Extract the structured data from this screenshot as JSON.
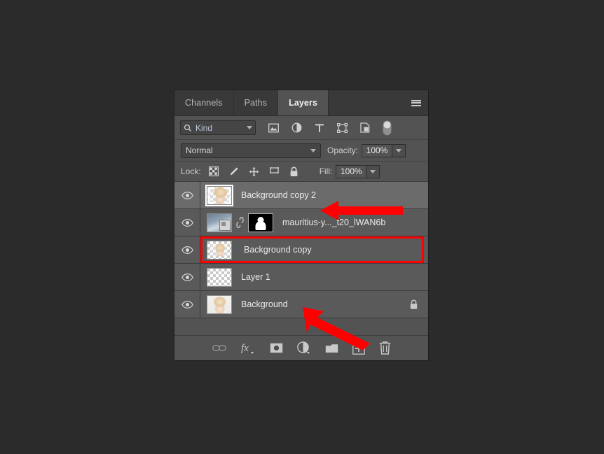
{
  "panel": {
    "tabs": [
      {
        "label": "Channels",
        "active": false
      },
      {
        "label": "Paths",
        "active": false
      },
      {
        "label": "Layers",
        "active": true
      }
    ],
    "menu_icon": "hamburger-menu-icon"
  },
  "filter": {
    "search_icon": "search-icon",
    "kind_value": "Kind",
    "kind_chevron": "chevron-down-icon",
    "type_filters": [
      {
        "name": "pixel-layer-filter-icon",
        "title": "Filter for pixel layers"
      },
      {
        "name": "adjustment-layer-filter-icon",
        "title": "Filter for adjustment layers"
      },
      {
        "name": "type-layer-filter-icon",
        "title": "Filter for type layers"
      },
      {
        "name": "shape-layer-filter-icon",
        "title": "Filter for shape layers"
      },
      {
        "name": "smart-object-filter-icon",
        "title": "Filter for smart objects"
      }
    ],
    "toggle_icon": "filter-toggle-switch"
  },
  "blend": {
    "mode_value": "Normal",
    "mode_chevron": "chevron-down-icon",
    "opacity_label": "Opacity:",
    "opacity_value": "100%",
    "opacity_chevron": "chevron-down-icon"
  },
  "lock": {
    "label": "Lock:",
    "icons": [
      {
        "name": "lock-transparent-pixels-icon"
      },
      {
        "name": "lock-image-pixels-icon"
      },
      {
        "name": "lock-position-icon"
      },
      {
        "name": "lock-artboard-nesting-icon"
      },
      {
        "name": "lock-all-icon"
      }
    ],
    "fill_label": "Fill:",
    "fill_value": "100%",
    "fill_chevron": "chevron-down-icon"
  },
  "layers": [
    {
      "name": "Background copy 2",
      "visible": true,
      "selected": true,
      "thumb": "photo-transparent-transform",
      "locked": false,
      "has_mask": false,
      "highlighted": false
    },
    {
      "name": "mauritius-y..._t20_lWAN6b",
      "visible": true,
      "selected": false,
      "thumb": "smart-object",
      "locked": false,
      "has_mask": true,
      "link_icon": "link-icon",
      "highlighted": false
    },
    {
      "name": "Background copy",
      "visible": true,
      "selected": false,
      "thumb": "photo-transparent",
      "locked": false,
      "has_mask": false,
      "highlighted": true
    },
    {
      "name": "Layer 1",
      "visible": true,
      "selected": false,
      "thumb": "transparent-empty",
      "locked": false,
      "has_mask": false,
      "highlighted": false
    },
    {
      "name": "Background",
      "visible": true,
      "selected": false,
      "thumb": "photo-full",
      "locked": true,
      "has_mask": false,
      "highlighted": false
    }
  ],
  "bottom_bar": {
    "buttons": [
      {
        "name": "link-layers-button",
        "icon": "link-icon"
      },
      {
        "name": "layer-style-button",
        "icon": "fx-icon"
      },
      {
        "name": "add-layer-mask-button",
        "icon": "mask-icon"
      },
      {
        "name": "new-adjustment-layer-button",
        "icon": "half-circle-icon"
      },
      {
        "name": "new-group-button",
        "icon": "folder-icon"
      },
      {
        "name": "new-layer-button",
        "icon": "plus-square-icon"
      },
      {
        "name": "delete-layer-button",
        "icon": "trash-icon"
      }
    ]
  },
  "annotations": {
    "accent_color": "#ff0000",
    "arrow_to_selected_layer": "left-pointing-arrow",
    "arrow_to_new_layer_button": "diagonal-arrow",
    "highlight_box_target": "Background copy"
  }
}
